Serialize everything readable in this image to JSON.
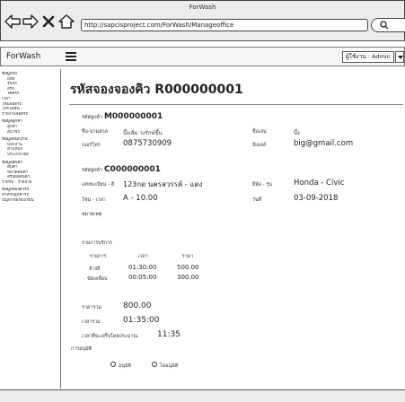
{
  "window": {
    "title": "ForWash"
  },
  "browser": {
    "url": "http://sapcisproject.com/ForWash/Manageoffice"
  },
  "header": {
    "brand": "ForWash",
    "user_label": "ผู้ใช้งาน : Admin"
  },
  "sidebar": {
    "items": [
      {
        "label": "ข้อมูลรถ",
        "kind": "cat"
      },
      {
        "label": "ยี่ห้อ",
        "kind": "sub"
      },
      {
        "label": "รุ่นรถ",
        "kind": "sub"
      },
      {
        "label": "สีรถ",
        "kind": "sub"
      },
      {
        "label": "ไซส์รถ",
        "kind": "sub"
      },
      {
        "label": "เวลา",
        "kind": "flat"
      },
      {
        "label": "โซนจอดรถ",
        "kind": "flat"
      },
      {
        "label": "โปรโมชั่น",
        "kind": "flat"
      },
      {
        "label": "รายงานจอดรถ",
        "kind": "flat"
      },
      {
        "label": "ข้อมูลลูกค้า",
        "kind": "cat"
      },
      {
        "label": "ลูกค้า",
        "kind": "sub"
      },
      {
        "label": "สมาชิก",
        "kind": "sub"
      },
      {
        "label": "ข้อมูลพนักงาน",
        "kind": "cat"
      },
      {
        "label": "พนักงาน",
        "kind": "sub"
      },
      {
        "label": "ตำแหน่ง",
        "kind": "sub"
      },
      {
        "label": "ประเภทไซส์",
        "kind": "sub"
      },
      {
        "label": "ข้อมูลสินค้า",
        "kind": "cat"
      },
      {
        "label": "สินค้า",
        "kind": "sub"
      },
      {
        "label": "หมวดสินค้า",
        "kind": "sub"
      },
      {
        "label": "สรุปผลสินค้า",
        "kind": "sub"
      },
      {
        "label": "รายรับ - รายจ่าย",
        "kind": "flat"
      },
      {
        "label": "ข้อมูลจองคิวรถ",
        "kind": "cat"
      },
      {
        "label": "สำหรับลูกค้ารถ",
        "kind": "flat"
      },
      {
        "label": "ปัญหาข้อร้องเรียน",
        "kind": "flat"
      }
    ]
  },
  "page": {
    "title": "รหัสจองจองคิว R000000001"
  },
  "member": {
    "code_label": "รหัสลูกค้า",
    "code": "M000000001",
    "name_label": "ชื่อ-นามสกุล",
    "name": "บึ้งเลิ่ม วงรักษ์ขึ้น",
    "phone_label": "เบอร์โทร",
    "phone": "0875730909",
    "nick_label": "ชื่อเล่น",
    "nick": "บึ้ง",
    "email_label": "อีเมลล์",
    "email": "big@gmail.com"
  },
  "car": {
    "code_label": "รหัสลูกค้า",
    "code": "C000000001",
    "plate_label": "เลขทะเบียน - สี",
    "plate": "123กด นครสวรรค์ - แดง",
    "zone_label": "โซน - เวลา",
    "zone": "A - 10.00",
    "note_label": "หมายเหตุ",
    "brand_label": "ยี่ห้อ - รุ่น",
    "brand": "Honda - Civic",
    "date_label": "วันที่",
    "date": "03-09-2018"
  },
  "services": {
    "section_label": "รายการบริการ",
    "headers": [
      "รายการ",
      "เวลา",
      "ราคา"
    ],
    "rows": [
      {
        "name": "ล้างสี",
        "time": "01:30:00",
        "price": "500.00"
      },
      {
        "name": "ขัดเคลือบ",
        "time": "00:05:00",
        "price": "300.00"
      }
    ]
  },
  "totals": {
    "price_label": "ราคารวม",
    "price": "800.00",
    "time_label": "เวลารวม",
    "time": "01:35:00",
    "finish_label": "เวลาที่จะเสร็จโดยประมาณ",
    "finish": "11:35"
  },
  "approval": {
    "label": "การอนุมัติ",
    "approve": "อนุมัติ",
    "reject": "ไม่อนุมัติ"
  }
}
